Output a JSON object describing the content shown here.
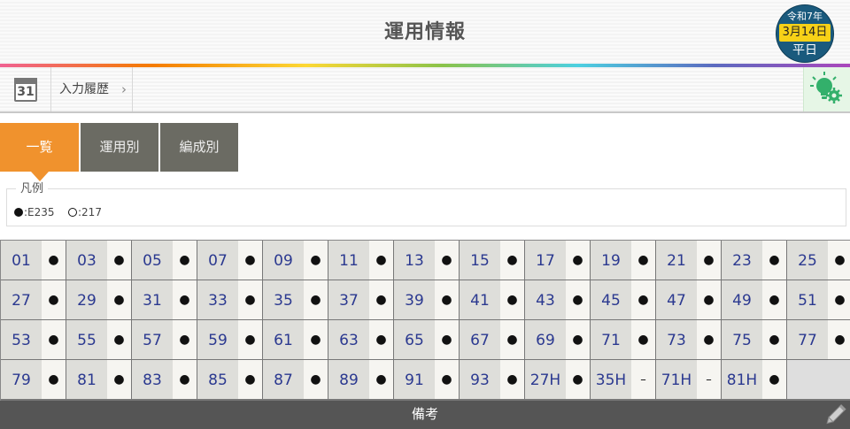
{
  "header": {
    "title": "運用情報",
    "date_badge": {
      "era": "令和7年",
      "day": "3月14日",
      "type": "平日"
    }
  },
  "subbar": {
    "calendar_day": "31",
    "history_label": "入力履歴",
    "history_chevron": "›",
    "calendar_icon": "calendar-icon",
    "idea_icon": "lightbulb-gear-icon"
  },
  "tabs": [
    {
      "label": "一覧",
      "active": true
    },
    {
      "label": "運用別",
      "active": false
    },
    {
      "label": "編成別",
      "active": false
    }
  ],
  "legend": {
    "title": "凡例",
    "items": [
      {
        "symbol": "filled-dot",
        "text": ":E235"
      },
      {
        "symbol": "hollow-dot",
        "text": ":217"
      }
    ]
  },
  "runs": [
    {
      "no": "01",
      "mark": "●"
    },
    {
      "no": "03",
      "mark": "●"
    },
    {
      "no": "05",
      "mark": "●"
    },
    {
      "no": "07",
      "mark": "●"
    },
    {
      "no": "09",
      "mark": "●"
    },
    {
      "no": "11",
      "mark": "●"
    },
    {
      "no": "13",
      "mark": "●"
    },
    {
      "no": "15",
      "mark": "●"
    },
    {
      "no": "17",
      "mark": "●"
    },
    {
      "no": "19",
      "mark": "●"
    },
    {
      "no": "21",
      "mark": "●"
    },
    {
      "no": "23",
      "mark": "●"
    },
    {
      "no": "25",
      "mark": "●"
    },
    {
      "no": "27",
      "mark": "●"
    },
    {
      "no": "29",
      "mark": "●"
    },
    {
      "no": "31",
      "mark": "●"
    },
    {
      "no": "33",
      "mark": "●"
    },
    {
      "no": "35",
      "mark": "●"
    },
    {
      "no": "37",
      "mark": "●"
    },
    {
      "no": "39",
      "mark": "●"
    },
    {
      "no": "41",
      "mark": "●"
    },
    {
      "no": "43",
      "mark": "●"
    },
    {
      "no": "45",
      "mark": "●"
    },
    {
      "no": "47",
      "mark": "●"
    },
    {
      "no": "49",
      "mark": "●"
    },
    {
      "no": "51",
      "mark": "●"
    },
    {
      "no": "53",
      "mark": "●"
    },
    {
      "no": "55",
      "mark": "●"
    },
    {
      "no": "57",
      "mark": "●"
    },
    {
      "no": "59",
      "mark": "●"
    },
    {
      "no": "61",
      "mark": "●"
    },
    {
      "no": "63",
      "mark": "●"
    },
    {
      "no": "65",
      "mark": "●"
    },
    {
      "no": "67",
      "mark": "●"
    },
    {
      "no": "69",
      "mark": "●"
    },
    {
      "no": "71",
      "mark": "●"
    },
    {
      "no": "73",
      "mark": "●"
    },
    {
      "no": "75",
      "mark": "●"
    },
    {
      "no": "77",
      "mark": "●"
    },
    {
      "no": "79",
      "mark": "●"
    },
    {
      "no": "81",
      "mark": "●"
    },
    {
      "no": "83",
      "mark": "●"
    },
    {
      "no": "85",
      "mark": "●"
    },
    {
      "no": "87",
      "mark": "●"
    },
    {
      "no": "89",
      "mark": "●"
    },
    {
      "no": "91",
      "mark": "●"
    },
    {
      "no": "93",
      "mark": "●"
    },
    {
      "no": "27H",
      "mark": "●"
    },
    {
      "no": "35H",
      "mark": "–"
    },
    {
      "no": "71H",
      "mark": "–"
    },
    {
      "no": "81H",
      "mark": "●"
    }
  ],
  "colors": {
    "accent_orange": "#f0922d",
    "tab_gray": "#6b6b63",
    "run_number_blue": "#2b3990",
    "date_badge_blue": "#1a5a7d",
    "date_badge_yellow": "#f7d117"
  },
  "footer": {
    "label": "備考",
    "edit_icon": "pencil-icon"
  }
}
